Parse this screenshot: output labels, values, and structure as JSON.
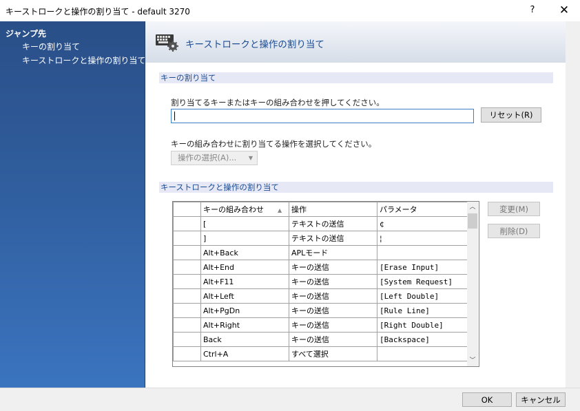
{
  "window": {
    "title": "キーストロークと操作の割り当て - default 3270",
    "help_label": "?",
    "close_label": "✕"
  },
  "sidebar": {
    "header": "ジャンプ先",
    "items": [
      {
        "label": "キーの割り当て"
      },
      {
        "label": "キーストロークと操作の割り当て"
      }
    ]
  },
  "banner": {
    "title": "キーストロークと操作の割り当て",
    "icon": "keyboard-gear-icon"
  },
  "key_assign": {
    "section_title": "キーの割り当て",
    "prompt": "割り当てるキーまたはキーの組み合わせを押してください。",
    "input_value": "",
    "reset_label": "リセット(R)",
    "action_prompt": "キーの組み合わせに割り当てる操作を選択してください。",
    "action_select": "操作の選択(A)..."
  },
  "mapping": {
    "section_title": "キーストロークと操作の割り当て",
    "columns": [
      "キーの組み合わせ",
      "操作",
      "パラメータ"
    ],
    "rows": [
      {
        "key": "[",
        "action": "テキストの送信",
        "param": "¢"
      },
      {
        "key": "]",
        "action": "テキストの送信",
        "param": "¦"
      },
      {
        "key": "Alt+Back",
        "action": "APLモード",
        "param": ""
      },
      {
        "key": "Alt+End",
        "action": "キーの送信",
        "param": "[Erase Input]"
      },
      {
        "key": "Alt+F11",
        "action": "キーの送信",
        "param": "[System Request]"
      },
      {
        "key": "Alt+Left",
        "action": "キーの送信",
        "param": "[Left Double]"
      },
      {
        "key": "Alt+PgDn",
        "action": "キーの送信",
        "param": "[Rule Line]"
      },
      {
        "key": "Alt+Right",
        "action": "キーの送信",
        "param": "[Right Double]"
      },
      {
        "key": "Back",
        "action": "キーの送信",
        "param": "[Backspace]"
      },
      {
        "key": "Ctrl+A",
        "action": "すべて選択",
        "param": ""
      }
    ],
    "change_label": "変更(M)",
    "delete_label": "削除(D)"
  },
  "footer": {
    "ok_label": "OK",
    "cancel_label": "キャンセル"
  }
}
